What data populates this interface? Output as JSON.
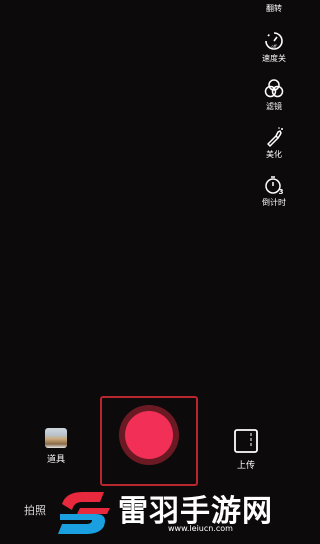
{
  "side_tools": [
    {
      "label": "翻转",
      "icon": "flip-icon"
    },
    {
      "label": "速度关",
      "icon": "speed-off-icon"
    },
    {
      "label": "滤镜",
      "icon": "filter-icon"
    },
    {
      "label": "美化",
      "icon": "beautify-wand-icon"
    },
    {
      "label": "倒计时",
      "icon": "countdown-timer-icon"
    }
  ],
  "bottom": {
    "props_label": "道具",
    "upload_label": "上传",
    "mode_label": "拍照"
  },
  "colors": {
    "record": "#f22f56",
    "record_ring": "#6b1a24",
    "frame": "#b8262e",
    "background": "#0d0a0c"
  },
  "watermark": {
    "text": "雷羽手游网",
    "url": "www.leiucn.com"
  }
}
